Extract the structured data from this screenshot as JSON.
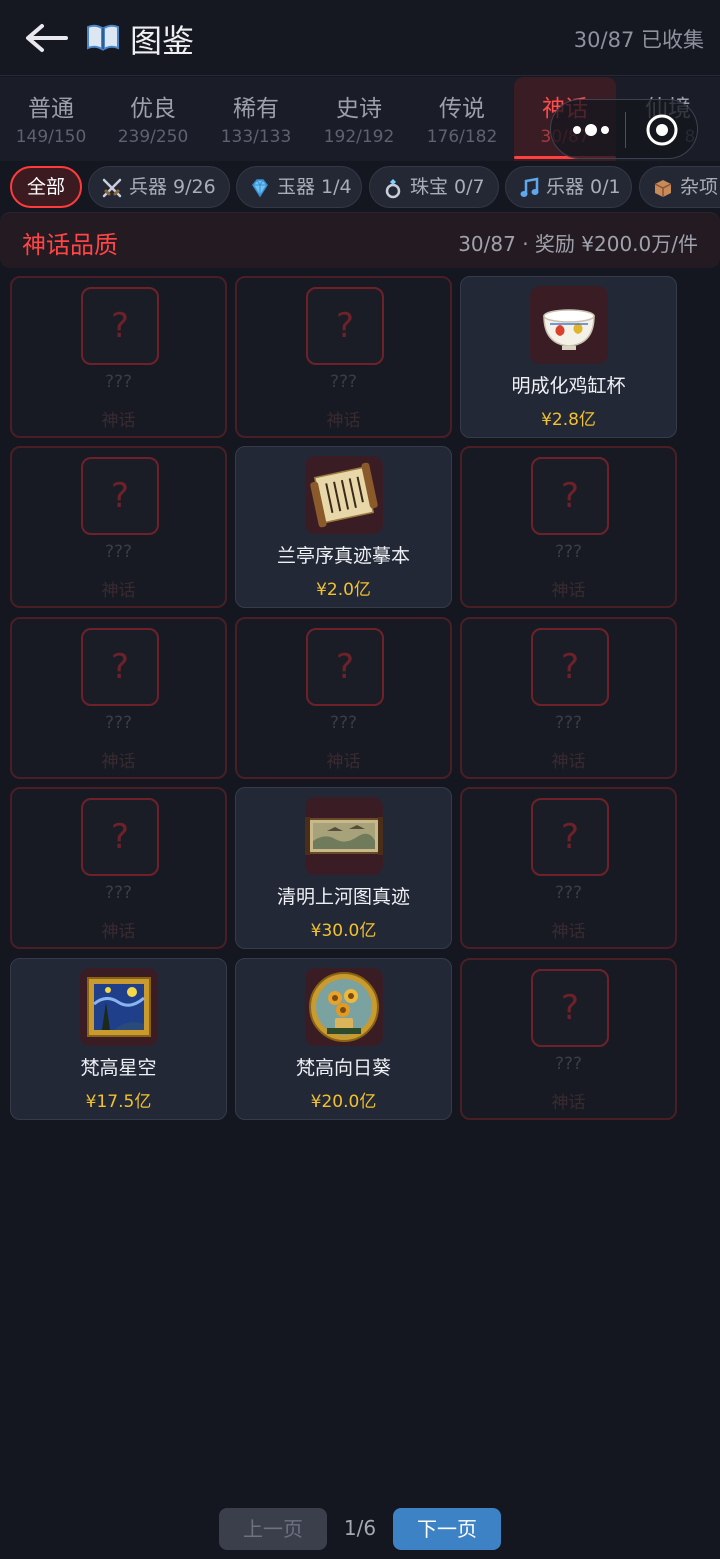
{
  "header": {
    "title": "图鉴",
    "collected": "30/87 已收集"
  },
  "tabs": [
    {
      "label": "普通",
      "count": "149/150"
    },
    {
      "label": "优良",
      "count": "239/250"
    },
    {
      "label": "稀有",
      "count": "133/133"
    },
    {
      "label": "史诗",
      "count": "192/192"
    },
    {
      "label": "传说",
      "count": "176/182"
    },
    {
      "label": "神话",
      "count": "30/87"
    },
    {
      "label": "仙境",
      "count": "8"
    }
  ],
  "chips": [
    {
      "label": "全部"
    },
    {
      "label": "兵器 9/26"
    },
    {
      "label": "玉器 1/4"
    },
    {
      "label": "珠宝 0/7"
    },
    {
      "label": "乐器 0/1"
    },
    {
      "label": "杂项"
    }
  ],
  "quality": {
    "title": "神话品质",
    "progress": "30/87 · 奖励 ¥200.0万/件"
  },
  "locked_card": {
    "mark": "?",
    "name": "???",
    "rarity": "神话"
  },
  "items": [
    {
      "name": "明成化鸡缸杯",
      "price": "¥2.8亿"
    },
    {
      "name": "兰亭序真迹摹本",
      "price": "¥2.0亿"
    },
    {
      "name": "清明上河图真迹",
      "price": "¥30.0亿"
    },
    {
      "name": "梵高星空",
      "price": "¥17.5亿"
    },
    {
      "name": "梵高向日葵",
      "price": "¥20.0亿"
    }
  ],
  "pager": {
    "prev": "上一页",
    "page": "1/6",
    "next": "下一页"
  },
  "colors": {
    "accent_red": "#ff4040",
    "price_gold": "#f2c12e",
    "next_blue": "#3d82c4"
  }
}
